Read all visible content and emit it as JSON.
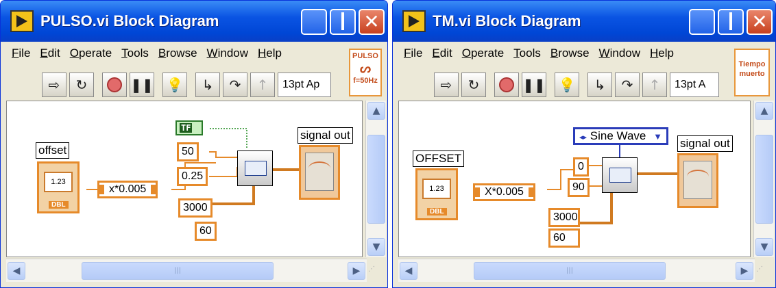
{
  "windows": [
    {
      "title": "PULSO.vi Block Diagram",
      "menu": [
        "File",
        "Edit",
        "Operate",
        "Tools",
        "Browse",
        "Window",
        "Help"
      ],
      "font_select": "13pt Ap",
      "vi_icon": {
        "line1": "PULSO",
        "line2": "f=50Hz"
      },
      "diagram": {
        "control_label": "offset",
        "control_value": "1.23",
        "control_type": "DBL",
        "expression": "x*0.005",
        "constants": [
          "50",
          "0.25",
          "3000",
          "60"
        ],
        "bool_value": "TF",
        "indicator_label": "signal out"
      }
    },
    {
      "title": "TM.vi Block Diagram",
      "menu": [
        "File",
        "Edit",
        "Operate",
        "Tools",
        "Browse",
        "Window",
        "Help"
      ],
      "font_select": "13pt A",
      "vi_icon": {
        "line1": "Tiempo",
        "line2": "muerto"
      },
      "diagram": {
        "control_label": "OFFSET",
        "control_value": "1.23",
        "control_type": "DBL",
        "expression": "X*0.005",
        "ring_value": "Sine Wave",
        "constants": [
          "0",
          "90",
          "3000",
          "60"
        ],
        "indicator_label": "signal out"
      }
    }
  ]
}
